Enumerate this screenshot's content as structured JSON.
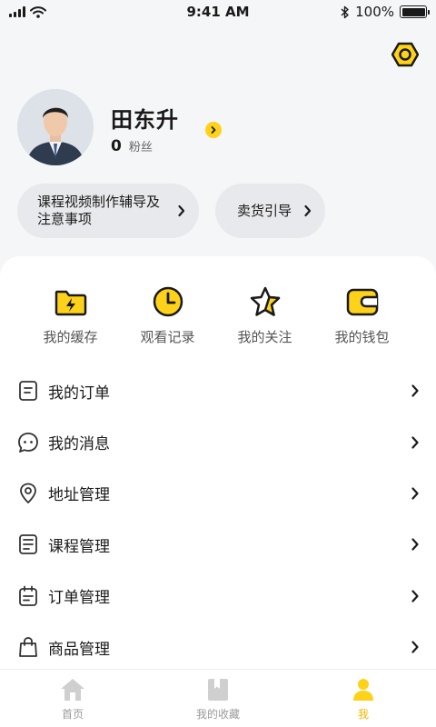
{
  "status_bar": {
    "time": "9:41 AM",
    "battery_text": "100%"
  },
  "profile": {
    "name": "田东升",
    "fans_count": "0",
    "fans_label": "粉丝"
  },
  "shortcuts": [
    {
      "label": "课程视频制作辅导及注意事项"
    },
    {
      "label": "卖货引导"
    }
  ],
  "quick_actions": [
    {
      "label": "我的缓存",
      "icon": "folder-lightning-icon"
    },
    {
      "label": "观看记录",
      "icon": "clock-icon"
    },
    {
      "label": "我的关注",
      "icon": "star-icon"
    },
    {
      "label": "我的钱包",
      "icon": "wallet-icon"
    }
  ],
  "menu": [
    {
      "label": "我的订单",
      "icon": "order-list-icon"
    },
    {
      "label": "我的消息",
      "icon": "message-icon"
    },
    {
      "label": "地址管理",
      "icon": "location-pin-icon"
    },
    {
      "label": "课程管理",
      "icon": "course-icon"
    },
    {
      "label": "订单管理",
      "icon": "calendar-order-icon"
    },
    {
      "label": "商品管理",
      "icon": "shopping-bag-icon"
    }
  ],
  "tabbar": [
    {
      "label": "首页",
      "icon": "home-icon",
      "active": false
    },
    {
      "label": "我的收藏",
      "icon": "bookmark-icon",
      "active": false
    },
    {
      "label": "我",
      "icon": "profile-icon",
      "active": true
    }
  ],
  "colors": {
    "accent": "#ffd21a",
    "active_tab": "#f5b800",
    "background": "#f5f6f8"
  }
}
